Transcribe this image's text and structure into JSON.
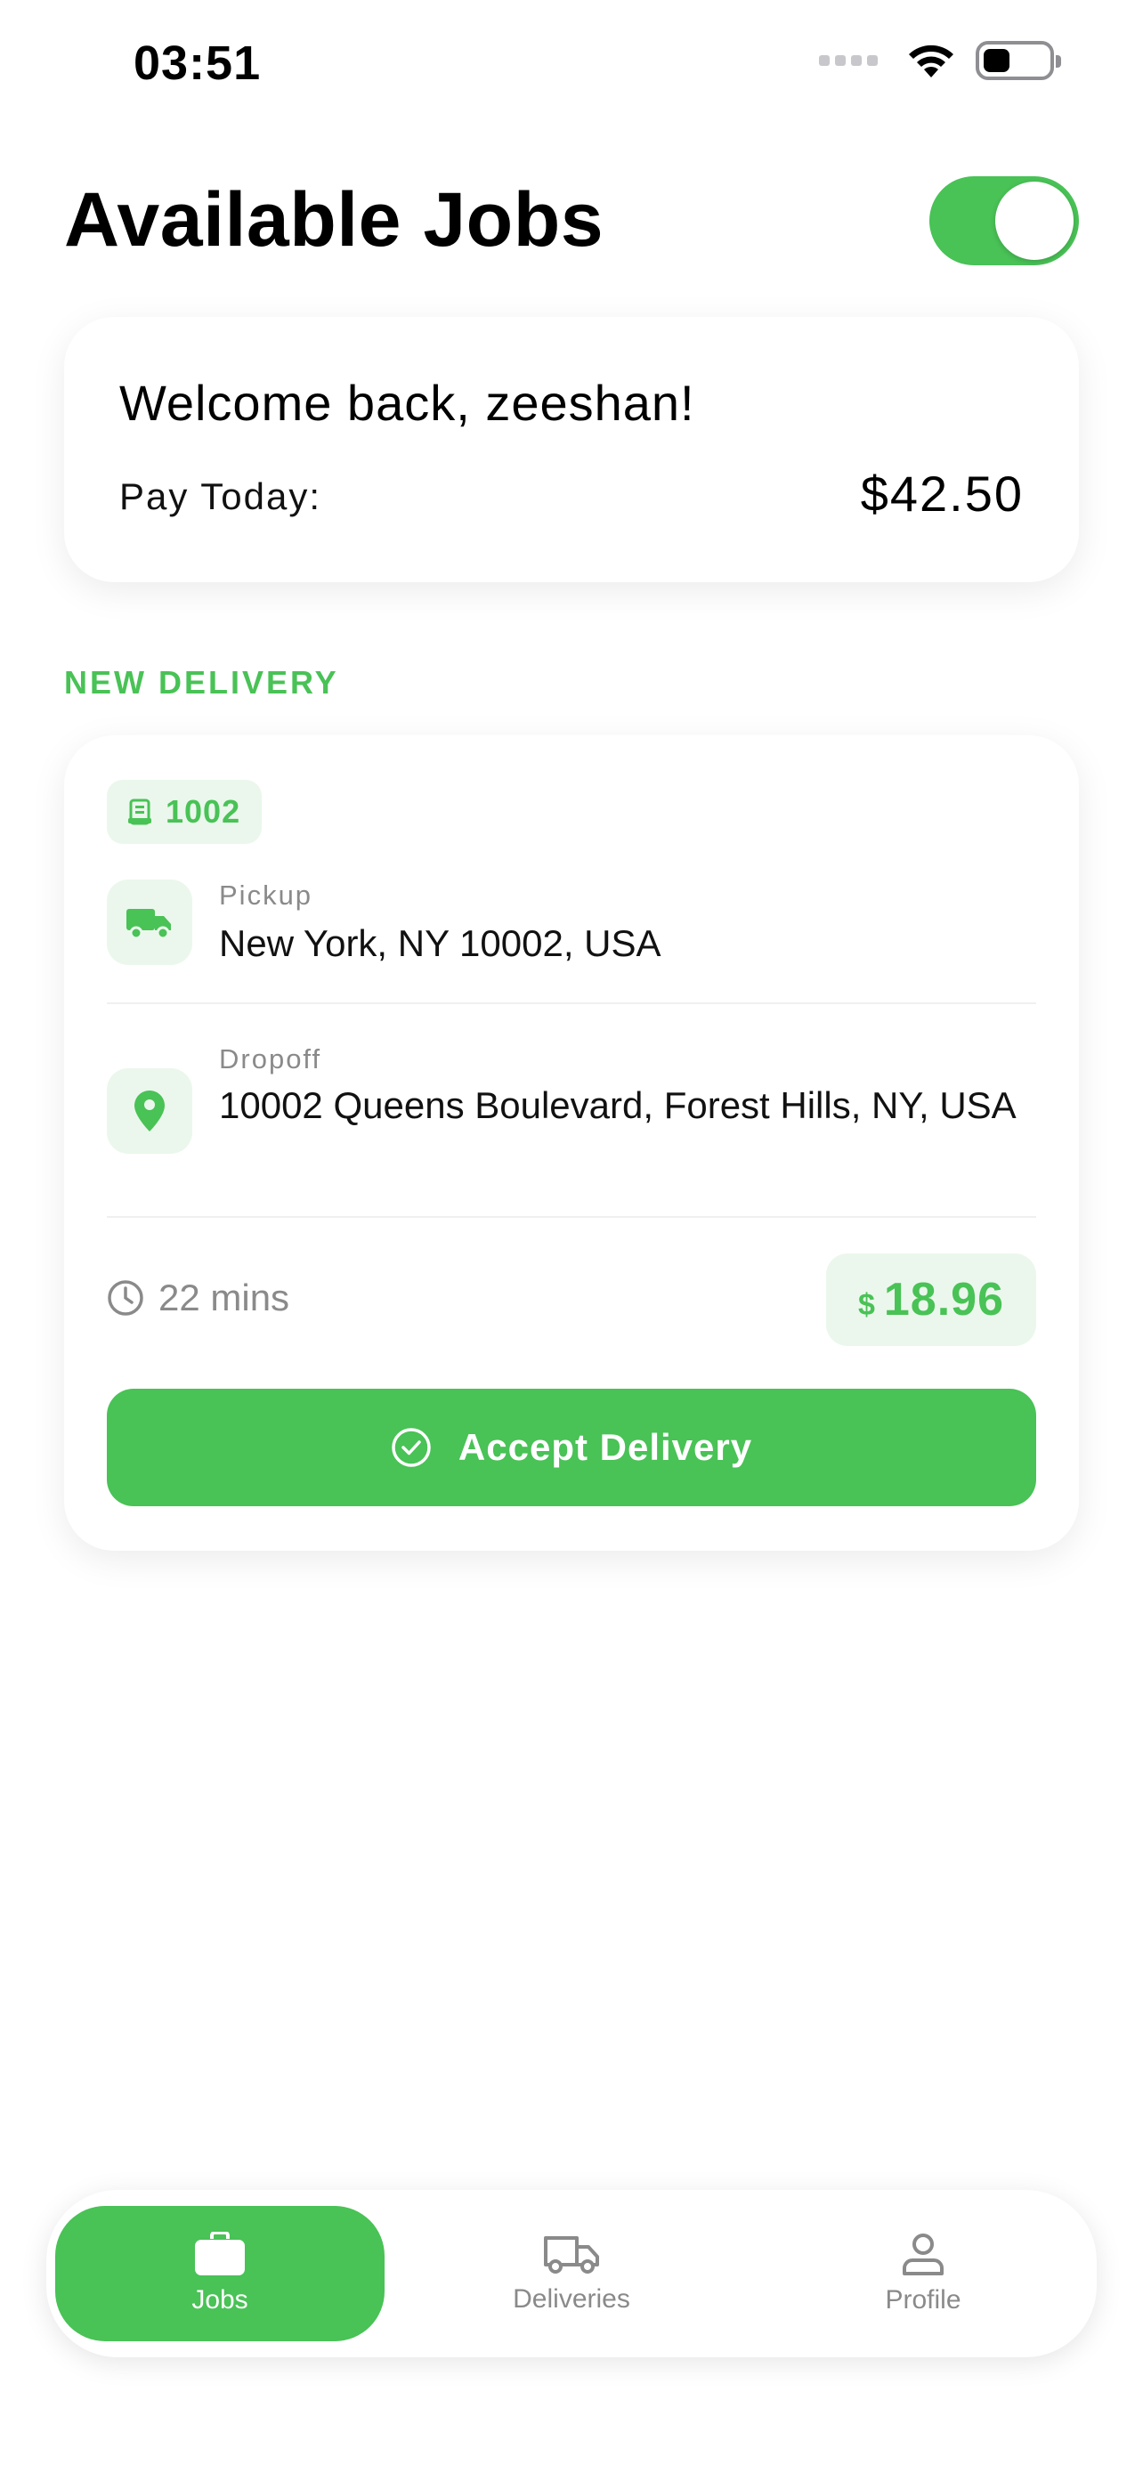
{
  "status_bar": {
    "time": "03:51"
  },
  "header": {
    "title": "Available Jobs",
    "toggle_on": true
  },
  "welcome": {
    "greeting": "Welcome back, zeeshan!",
    "pay_label": "Pay Today:",
    "pay_value": "$42.50"
  },
  "section": {
    "label": "NEW DELIVERY"
  },
  "delivery": {
    "order_id": "1002",
    "pickup": {
      "label": "Pickup",
      "address": "New York, NY 10002, USA"
    },
    "dropoff": {
      "label": "Dropoff",
      "address": "10002 Queens Boulevard, Forest Hills, NY, USA"
    },
    "eta": "22 mins",
    "price_currency": "$",
    "price_value": "18.96",
    "accept_label": "Accept Delivery"
  },
  "tabs": [
    {
      "label": "Jobs",
      "icon": "briefcase-icon",
      "active": true
    },
    {
      "label": "Deliveries",
      "icon": "truck-icon",
      "active": false
    },
    {
      "label": "Profile",
      "icon": "user-icon",
      "active": false
    }
  ],
  "colors": {
    "accent": "#49c256",
    "accent_light": "#ebf7ec",
    "muted": "#8a8a8a"
  }
}
